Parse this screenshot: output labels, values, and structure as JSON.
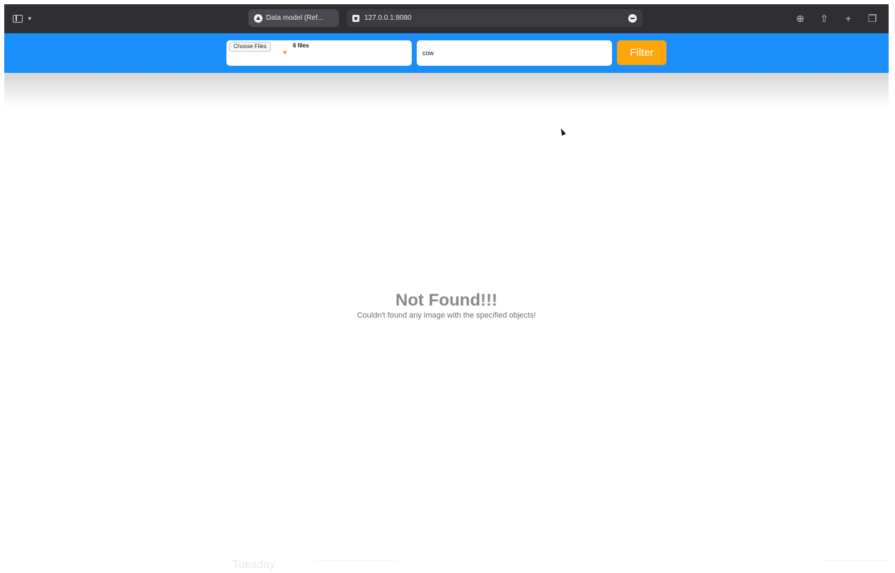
{
  "browser": {
    "active_tab_title": "Data model (Ref...",
    "url": "127.0.0.1:8080"
  },
  "toolbar": {
    "choose_files_label": "Choose Files",
    "file_count": "6 files",
    "search_value": "cow",
    "filter_label": "Filter"
  },
  "empty_state": {
    "title": "Not Found!!!",
    "message": "Couldn't found any image with the specified objects!"
  },
  "background": {
    "day_label": "Tuesday"
  },
  "colors": {
    "app_bar": "#1a8ffb",
    "filter_button": "#fca60b",
    "browser_chrome": "#2f2e33"
  }
}
